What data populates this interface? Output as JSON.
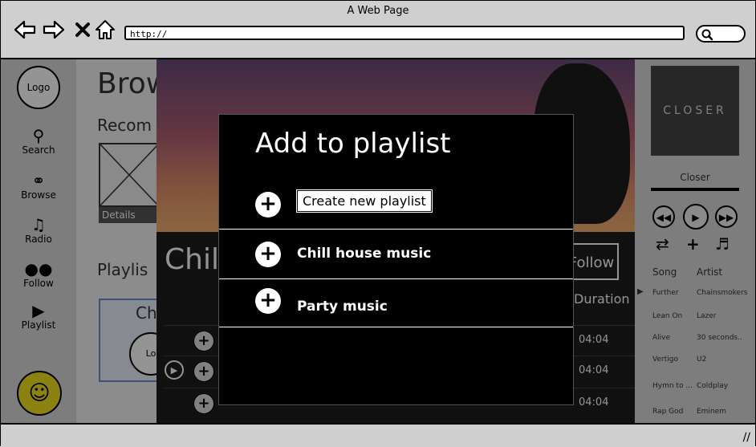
{
  "window": {
    "title": "A Web Page",
    "url": "http://"
  },
  "left_nav": {
    "logo": "Logo",
    "items": [
      {
        "label": "Search",
        "icon": "search-icon"
      },
      {
        "label": "Browse",
        "icon": "headphones-icon"
      },
      {
        "label": "Radio",
        "icon": "music-note-icon"
      },
      {
        "label": "Follow",
        "icon": "users-icon"
      },
      {
        "label": "Playlist",
        "icon": "play-icon"
      }
    ]
  },
  "main": {
    "title": "Brow",
    "recommended_title": "Recom",
    "details_label": "Details",
    "playlists_title": "Playlis",
    "playlist_card_title": "Ch",
    "playlist_card_logo": "Lo",
    "list_title": "Chil",
    "follow_label": "Follow",
    "duration_header": "Duration",
    "tracks": [
      {
        "duration": "04:04"
      },
      {
        "duration": "04:04"
      },
      {
        "duration": "04:04"
      }
    ]
  },
  "right_panel": {
    "album_text": "CLOSER",
    "now_playing": "Closer",
    "columns": {
      "song": "Song",
      "artist": "Artist"
    },
    "queue": [
      {
        "song": "Further",
        "artist": "Chainsmokers"
      },
      {
        "song": "Lean On",
        "artist": "Lazer"
      },
      {
        "song": "Alive",
        "artist": "30 seconds.."
      },
      {
        "song": "Vertigo",
        "artist": "U2"
      },
      {
        "song": "Hymn to ...",
        "artist": "Coldplay"
      },
      {
        "song": "Rap God",
        "artist": "Eminem"
      }
    ]
  },
  "modal": {
    "title": "Add to playlist",
    "create_label": "Create new playlist",
    "playlists": [
      "Chill house music",
      "Party music"
    ]
  }
}
